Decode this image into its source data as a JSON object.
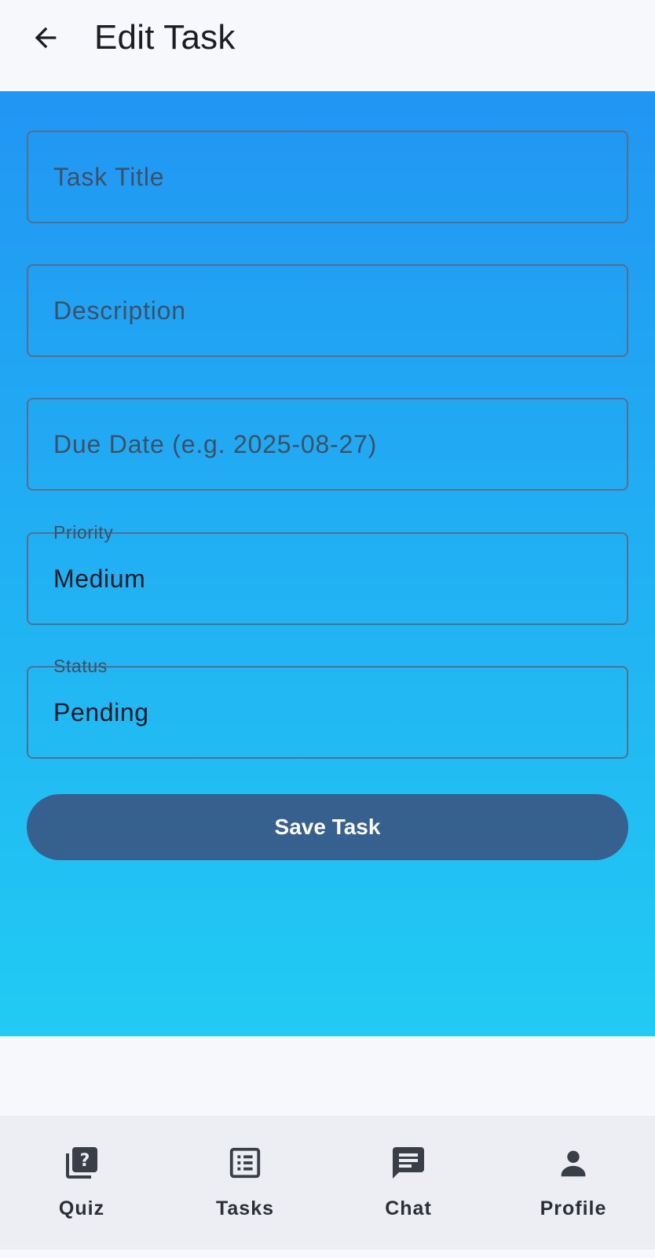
{
  "app_bar": {
    "title": "Edit Task",
    "back_icon": "arrow-back-icon"
  },
  "form": {
    "task_title": {
      "placeholder": "Task Title",
      "value": ""
    },
    "description": {
      "placeholder": "Description",
      "value": ""
    },
    "due_date": {
      "placeholder": "Due Date (e.g. 2025-08-27)",
      "value": ""
    },
    "priority": {
      "label": "Priority",
      "value": "Medium"
    },
    "status": {
      "label": "Status",
      "value": "Pending"
    },
    "save_label": "Save Task"
  },
  "colors": {
    "gradient_top": "#2196f3",
    "gradient_bottom": "#21cbf3",
    "button": "#36618e",
    "field_border": "#54708c",
    "bar_background": "#f7f8fc",
    "nav_background": "#eceef4"
  },
  "bottom_nav": {
    "items": [
      {
        "label": "Quiz",
        "icon": "quiz-icon"
      },
      {
        "label": "Tasks",
        "icon": "list-icon"
      },
      {
        "label": "Chat",
        "icon": "chat-icon"
      },
      {
        "label": "Profile",
        "icon": "person-icon"
      }
    ]
  }
}
